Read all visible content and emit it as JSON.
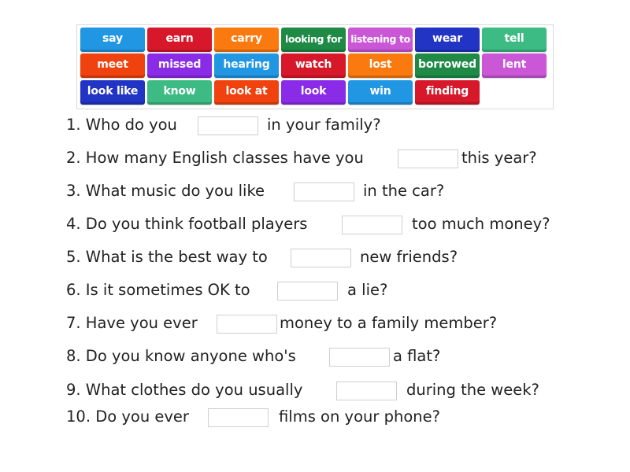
{
  "word_bank": {
    "tiles": [
      {
        "label": "say",
        "color": "#2196e3"
      },
      {
        "label": "earn",
        "color": "#d7182a"
      },
      {
        "label": "carry",
        "color": "#fa7a0f"
      },
      {
        "label": "looking for",
        "color": "#1e8a45"
      },
      {
        "label": "listening to",
        "color": "#c957d6"
      },
      {
        "label": "wear",
        "color": "#2234c4"
      },
      {
        "label": "tell",
        "color": "#3dbb84"
      },
      {
        "label": "meet",
        "color": "#f0420e"
      },
      {
        "label": "missed",
        "color": "#8a2be8"
      },
      {
        "label": "hearing",
        "color": "#2196e3"
      },
      {
        "label": "watch",
        "color": "#d7182a"
      },
      {
        "label": "lost",
        "color": "#fa7a0f"
      },
      {
        "label": "borrowed",
        "color": "#1e8a45"
      },
      {
        "label": "lent",
        "color": "#c957d6"
      },
      {
        "label": "look like",
        "color": "#2234c4"
      },
      {
        "label": "know",
        "color": "#3dbb84"
      },
      {
        "label": "look at",
        "color": "#f0420e"
      },
      {
        "label": "look",
        "color": "#8a2be8"
      },
      {
        "label": "win",
        "color": "#2196e3"
      },
      {
        "label": "finding",
        "color": "#d7182a"
      }
    ]
  },
  "questions": [
    {
      "before": "1. Who do you",
      "after": "in your family?"
    },
    {
      "before": "2. How many English classes have you",
      "after": "this year?"
    },
    {
      "before": "3. What music do you like",
      "after": "in the car?"
    },
    {
      "before": "4. Do you think football players",
      "after": "too much money?"
    },
    {
      "before": "5. What is the best way to",
      "after": "new friends?"
    },
    {
      "before": "6. Is it sometimes OK to",
      "after": "a lie?"
    },
    {
      "before": "7. Have you ever",
      "after": "money to a family member?"
    },
    {
      "before": "8. Do you know anyone who's",
      "after": "a flat?"
    },
    {
      "before": "9. What clothes do you usually",
      "after": "during the week?"
    },
    {
      "before": "10. Do you ever",
      "after": "films on your phone?"
    }
  ]
}
